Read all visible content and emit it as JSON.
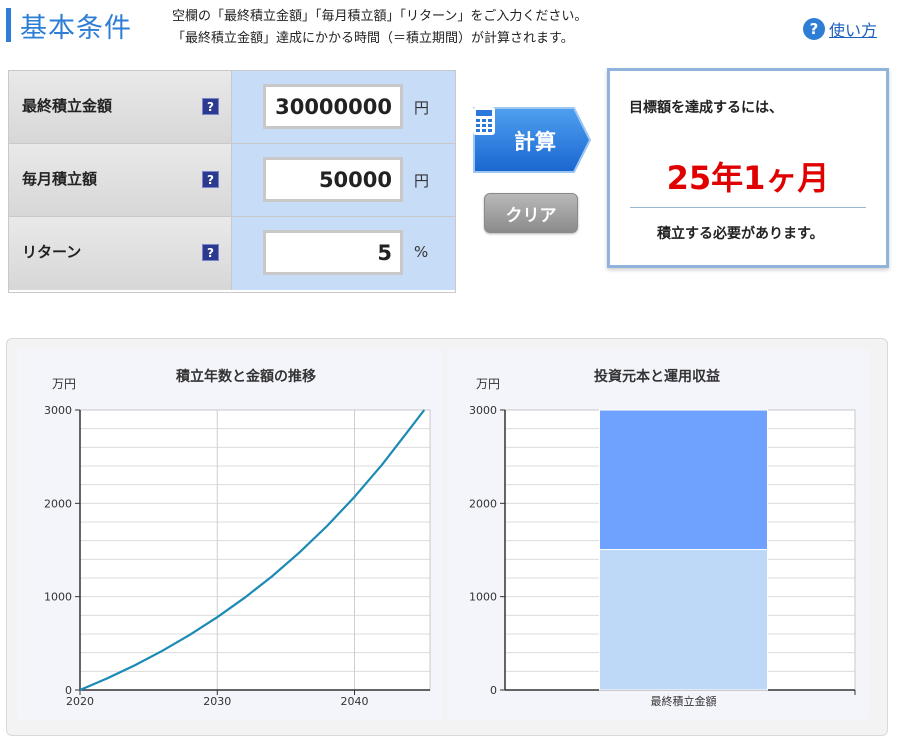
{
  "header": {
    "title": "基本条件",
    "desc_line1": "空欄の「最終積立金額」「毎月積立額」「リターン」をご入力ください。",
    "desc_line2": "「最終積立金額」達成にかかる時間（＝積立期間）が計算されます。",
    "help_icon": "?",
    "help_label": "使い方"
  },
  "form": {
    "rows": [
      {
        "label": "最終積立金額",
        "value": "30000000",
        "unit": "円"
      },
      {
        "label": "毎月積立額",
        "value": "50000",
        "unit": "円"
      },
      {
        "label": "リターン",
        "value": "5",
        "unit": "%"
      }
    ],
    "help_glyph": "?"
  },
  "buttons": {
    "calculate": "計算",
    "clear": "クリア"
  },
  "result": {
    "intro": "目標額を達成するには、",
    "period": "25年1ヶ月",
    "outro": "積立する必要があります。"
  },
  "colors": {
    "accent": "#2e7ed6",
    "result_red": "#e00000",
    "line": "#1b8ab5",
    "bar_top": "#6fa2ff",
    "bar_bottom": "#bdd9f7"
  },
  "chart_data": [
    {
      "type": "line",
      "title": "積立年数と金額の推移",
      "unit_label": "万円",
      "x": [
        2020,
        2022,
        2024,
        2026,
        2028,
        2030,
        2032,
        2034,
        2036,
        2038,
        2040,
        2042,
        2044,
        2045.08
      ],
      "y": [
        0,
        126,
        265,
        420,
        591,
        780,
        989,
        1219,
        1475,
        1757,
        2069,
        2413,
        2793,
        3000
      ],
      "xticks": [
        2020,
        2030,
        2040
      ],
      "yticks": [
        0,
        1000,
        2000,
        3000
      ],
      "xlim": [
        2020,
        2045.5
      ],
      "ylim": [
        0,
        3000
      ],
      "grid": true
    },
    {
      "type": "bar",
      "title": "投資元本と運用収益",
      "unit_label": "万円",
      "categories": [
        "最終積立金額"
      ],
      "series": [
        {
          "values": [
            1505
          ]
        },
        {
          "values": [
            1495
          ]
        }
      ],
      "stacked": true,
      "yticks": [
        0,
        1000,
        2000,
        3000
      ],
      "ylim": [
        0,
        3000
      ],
      "grid": true
    }
  ]
}
